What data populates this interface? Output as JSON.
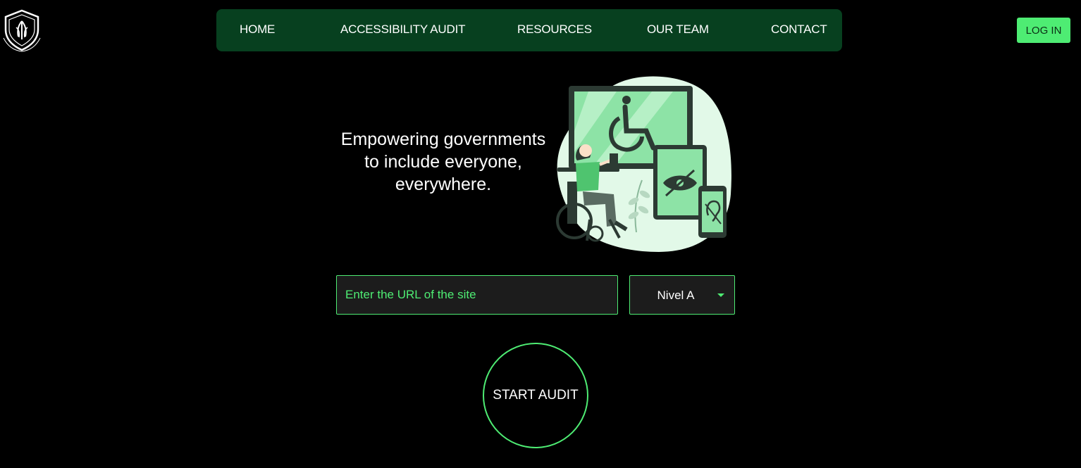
{
  "header": {
    "logo_icon": "shield-crest-icon",
    "nav": [
      {
        "label": "HOME"
      },
      {
        "label": "ACCESSIBILITY AUDIT"
      },
      {
        "label": "RESOURCES"
      },
      {
        "label": "OUR TEAM"
      },
      {
        "label": "CONTACT"
      }
    ],
    "login_label": "LOG IN"
  },
  "hero": {
    "tagline_lines": [
      "Empowering governments",
      "to include everyone,",
      "everywhere."
    ],
    "illustration_icon": "accessibility-devices-illustration"
  },
  "audit_form": {
    "url_placeholder": "Enter the URL of the site",
    "url_value": "",
    "level_selected": "Nivel A",
    "start_label": "START AUDIT"
  },
  "colors": {
    "accent": "#4eec73",
    "nav_bg": "#07401f",
    "page_bg": "#000000",
    "input_bg": "#1c1c1c"
  }
}
